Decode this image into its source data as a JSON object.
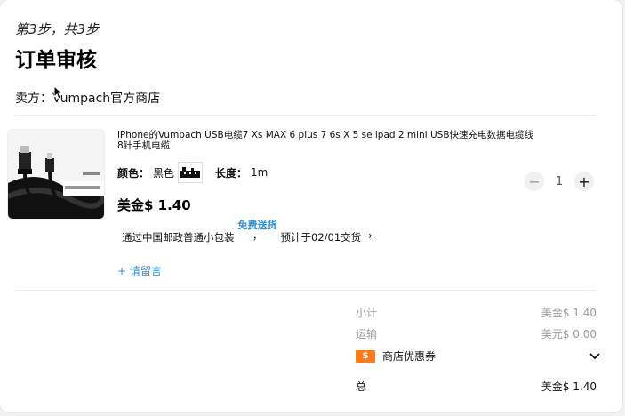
{
  "header": {
    "step": "第3步，共3步",
    "title": "订单审核",
    "seller": "卖方：Vumpach官方商店"
  },
  "item": {
    "title": "iPhone的Vumpach USB电缆7 Xs MAX 6 plus 7 6s X 5 se ipad 2 mini USB快速充电数据电缆线8针手机电缆",
    "color_label": "颜色：",
    "color_value": "黑色",
    "length_label": "长度：",
    "length_value": "1m",
    "price": "美金$ 1.40",
    "quantity": "1",
    "shipping_prefix": "通过中国邮政普通小包装",
    "shipping_free": "免费送货",
    "shipping_comma": "，",
    "shipping_eta": "预计于02/01交货",
    "note_link": "+ 请留言"
  },
  "summary": {
    "subtotal_label": "小计",
    "subtotal_value": "美金$ 1.40",
    "shipping_label": "运输",
    "shipping_value": "美元$ 0.00",
    "coupon_label": "商店优惠券",
    "coupon_icon_text": "$",
    "total_label": "总",
    "total_value": "美金$ 1.40"
  },
  "colors": {
    "accent_blue": "#2f8fd8",
    "coupon_orange": "#ff7a1a"
  }
}
